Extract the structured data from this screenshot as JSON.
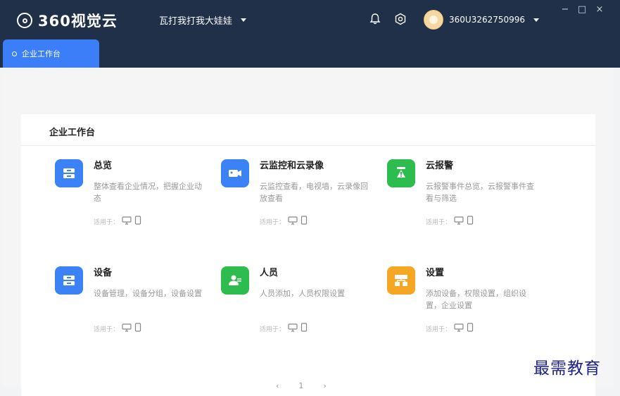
{
  "header": {
    "logo": "360视觉云",
    "org_name": "瓦打我打我大娃娃",
    "username": "360U3262750996"
  },
  "window_controls": {
    "minimize": "−",
    "maximize": "□",
    "close": "×"
  },
  "tabs": [
    {
      "label": "企业工作台"
    }
  ],
  "workbench": {
    "title": "企业工作台",
    "tiles": [
      {
        "title": "总览",
        "desc": "整体查看企业情况，把握企业动态",
        "applies": "适用于：",
        "color": "#3b82f6",
        "icon": "overview-icon"
      },
      {
        "title": "云监控和云录像",
        "desc": "云监控查看，电视墙，云录像回放查看",
        "applies": "适用于：",
        "color": "#3b82f6",
        "icon": "camera-icon"
      },
      {
        "title": "云报警",
        "desc": "云报警事件总览，云报警事件查看与筛选",
        "applies": "适用于：",
        "color": "#2dbd4e",
        "icon": "alarm-icon"
      },
      {
        "title": "设备",
        "desc": "设备管理，设备分组，设备设置",
        "applies": "适用于：",
        "color": "#3b82f6",
        "icon": "device-icon"
      },
      {
        "title": "人员",
        "desc": "人员添加，人员权限设置",
        "applies": "适用于：",
        "color": "#2dbd4e",
        "icon": "people-icon"
      },
      {
        "title": "设置",
        "desc": "添加设备，权限设置，组织设置，企业设置",
        "applies": "适用于：",
        "color": "#f5a623",
        "icon": "settings-org-icon"
      }
    ]
  },
  "pager": {
    "prev": "‹",
    "page": "1",
    "next": "›"
  },
  "watermark": "最需教育"
}
